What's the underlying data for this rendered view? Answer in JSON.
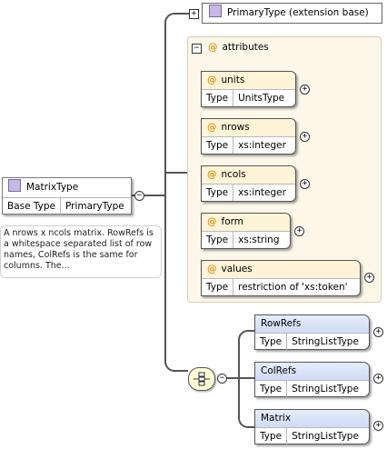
{
  "main_type": {
    "name": "MatrixType",
    "base_label": "Base Type",
    "base_value": "PrimaryType"
  },
  "documentation": "A nrows x ncols matrix. RowRefs is a whitespace separated list of row names, ColRefs is the same for columns. The...",
  "extension": {
    "label": "PrimaryType (extension base)"
  },
  "attributes_group": {
    "label": "attributes"
  },
  "attributes": [
    {
      "name": "units",
      "type_label": "Type",
      "type": "UnitsType"
    },
    {
      "name": "nrows",
      "type_label": "Type",
      "type": "xs:integer"
    },
    {
      "name": "ncols",
      "type_label": "Type",
      "type": "xs:integer"
    },
    {
      "name": "form",
      "type_label": "Type",
      "type": "xs:string"
    },
    {
      "name": "values",
      "type_label": "Type",
      "type": "restriction of 'xs:token'"
    }
  ],
  "elements": [
    {
      "name": "RowRefs",
      "type_label": "Type",
      "type": "StringListType"
    },
    {
      "name": "ColRefs",
      "type_label": "Type",
      "type": "StringListType"
    },
    {
      "name": "Matrix",
      "type_label": "Type",
      "type": "StringListType"
    }
  ],
  "icons": {
    "expand": "plus-icon",
    "collapse": "minus-icon",
    "attribute": "at-icon",
    "type": "complex-type-icon",
    "sequence": "sequence-icon"
  },
  "colors": {
    "attr_group_bg": "#fdf7ea",
    "attr_header": "#fff3d8",
    "element_header": "#cfdcf5",
    "attr_marker": "#e09a1c",
    "type_icon": "#c8b8e8"
  }
}
